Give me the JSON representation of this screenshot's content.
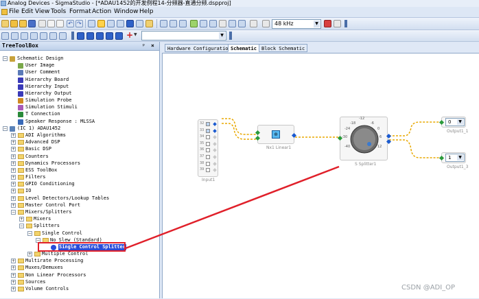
{
  "window": {
    "title": "Analog Devices - SigmaStudio - [*ADAU1452的开发例程14-分频器-直通分频.dspproj]"
  },
  "menu": [
    "File",
    "Edit",
    "View",
    "Tools",
    "Format",
    "Action",
    "Window",
    "Help"
  ],
  "toolbar": {
    "sample_rate": "48 kHz"
  },
  "left_panel": {
    "title": "TreeToolBox",
    "pin": "ᵖ",
    "close": "×",
    "items": [
      {
        "label": "Schematic Design"
      },
      {
        "label": "User Image"
      },
      {
        "label": "User Comment"
      },
      {
        "label": "Hierarchy Board"
      },
      {
        "label": "Hierarchy Input"
      },
      {
        "label": "Hierarchy Output"
      },
      {
        "label": "Simulation Probe"
      },
      {
        "label": "Simulation Stimuli"
      },
      {
        "label": "T Connection"
      },
      {
        "label": "Speaker Response : MLSSA"
      },
      {
        "label": "(IC 1) ADAU1452"
      },
      {
        "label": "ADI Algorithms"
      },
      {
        "label": "Advanced DSP"
      },
      {
        "label": "Basic DSP"
      },
      {
        "label": "Counters"
      },
      {
        "label": "Dynamics Processors"
      },
      {
        "label": "ESS ToolBox"
      },
      {
        "label": "Filters"
      },
      {
        "label": "GPIO Conditioning"
      },
      {
        "label": "IO"
      },
      {
        "label": "Level Detectors/Lookup Tables"
      },
      {
        "label": "Master Control Port"
      },
      {
        "label": "Mixers/Splitters"
      },
      {
        "label": "Mixers"
      },
      {
        "label": "Splitters"
      },
      {
        "label": "Single Control"
      },
      {
        "label": "No Slew (Standard)"
      },
      {
        "label": "Single Control Splitter"
      },
      {
        "label": "Multiple Control"
      },
      {
        "label": "Multirate Processing"
      },
      {
        "label": "Muxes/Demuxes"
      },
      {
        "label": "Non Linear Processors"
      },
      {
        "label": "Sources"
      },
      {
        "label": "Volume Controls"
      }
    ]
  },
  "tabs": [
    "Hardware Configuration",
    "Schematic",
    "Block Schematic"
  ],
  "canvas": {
    "input_block": {
      "label": "Input1",
      "channels": [
        "32",
        "33",
        "34",
        "35",
        "36",
        "37",
        "38",
        "39"
      ]
    },
    "nx1_block": {
      "label": "Nx1 Linear1"
    },
    "splitter_block": {
      "label": "S Splitter1",
      "dial_ticks": [
        "-12",
        "-18",
        "-6",
        "-24",
        "0",
        "-30",
        "6",
        "-40",
        "12"
      ]
    },
    "output1": {
      "label": "Output1_1",
      "value": "0"
    },
    "output2": {
      "label": "Output1_3",
      "value": "1"
    }
  },
  "watermark": "CSDN @ADI_OP",
  "colors": {
    "highlight_red": "#e0202a",
    "wire_gold": "#e8a800",
    "selection_blue": "#2a4cd8"
  }
}
